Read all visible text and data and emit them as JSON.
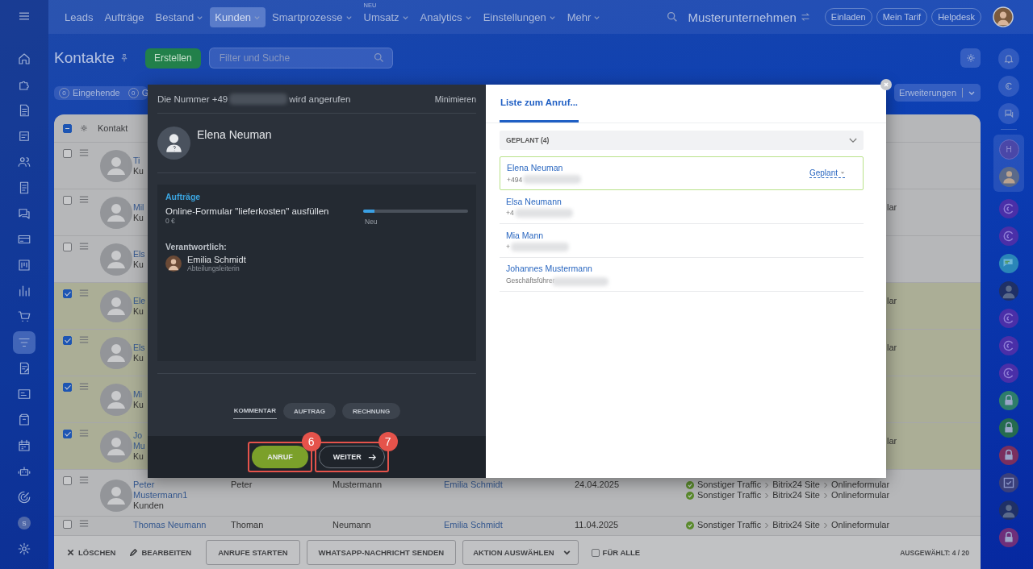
{
  "sidebar": {
    "items": [
      {
        "selected": false
      },
      {
        "selected": false
      },
      {
        "selected": false
      },
      {
        "selected": false
      },
      {
        "selected": false
      },
      {
        "selected": false
      },
      {
        "selected": false
      },
      {
        "selected": false
      },
      {
        "selected": false
      },
      {
        "selected": false
      },
      {
        "selected": false
      },
      {
        "selected": true
      },
      {
        "selected": false
      },
      {
        "selected": false
      },
      {
        "selected": false
      },
      {
        "selected": false
      },
      {
        "selected": false
      },
      {
        "selected": false
      }
    ],
    "user_initial": "S"
  },
  "top_nav": {
    "items": [
      {
        "label": "Leads",
        "selected": false,
        "dropdown": false
      },
      {
        "label": "Aufträge",
        "selected": false,
        "dropdown": false
      },
      {
        "label": "Bestand",
        "selected": false,
        "dropdown": true
      },
      {
        "label": "Kunden",
        "selected": true,
        "dropdown": true
      },
      {
        "label": "Smartprozesse",
        "selected": false,
        "dropdown": true
      },
      {
        "label": "Umsatz",
        "selected": false,
        "dropdown": true,
        "badge": "NEU"
      },
      {
        "label": "Analytics",
        "selected": false,
        "dropdown": true
      },
      {
        "label": "Einstellungen",
        "selected": false,
        "dropdown": true
      },
      {
        "label": "Mehr",
        "selected": false,
        "dropdown": true
      }
    ],
    "company": "Musterunternehmen",
    "buttons": [
      "Einladen",
      "Mein Tarif",
      "Helpdesk"
    ]
  },
  "page": {
    "title": "Kontakte",
    "create_button": "Erstellen",
    "search": {
      "placeholder": "Filter und Suche"
    },
    "counters": [
      {
        "count": "0",
        "label": "Eingehende"
      },
      {
        "count": "0",
        "label": "G"
      }
    ],
    "extensions_button": "Erweiterungen"
  },
  "table": {
    "header": {
      "indeterminate": true,
      "label": "Kontakt"
    },
    "rows": [
      {
        "kind": "covered",
        "checked": false,
        "name_lines": [
          "Ti"
        ],
        "subtitle": "Ku"
      },
      {
        "kind": "covered",
        "checked": false,
        "name_lines": [
          "Mil"
        ],
        "subtitle": "Ku",
        "tail": "lar"
      },
      {
        "kind": "covered",
        "checked": false,
        "name_lines": [
          "Els"
        ],
        "subtitle": "Ku"
      },
      {
        "kind": "covered",
        "checked": true,
        "name_lines": [
          "Ele"
        ],
        "subtitle": "Ku",
        "tail": "lar"
      },
      {
        "kind": "covered",
        "checked": true,
        "name_lines": [
          "Els"
        ],
        "subtitle": "Ku",
        "tail": "lar"
      },
      {
        "kind": "covered",
        "checked": true,
        "name_lines": [
          "Mi"
        ],
        "subtitle": "Ku"
      },
      {
        "kind": "covered",
        "checked": true,
        "name_lines": [
          "Jo",
          "Mu"
        ],
        "subtitle": "Ku",
        "tail": "lar"
      },
      {
        "kind": "full",
        "checked": false,
        "name_lines": [
          "Peter",
          "Mustermann1"
        ],
        "subtitle": "Kunden",
        "first_name": "Peter",
        "last_name": "Mustermann",
        "responsible": "Emilia Schmidt",
        "date": "24.04.2025",
        "sources": [
          [
            "Sonstiger Traffic",
            "Bitrix24 Site",
            "Onlineformular"
          ],
          [
            "Sonstiger Traffic",
            "Bitrix24 Site",
            "Onlineformular"
          ]
        ]
      },
      {
        "kind": "partial",
        "checked": false,
        "name_lines": [
          "Thomas Neumann"
        ],
        "first_name": "Thoman",
        "last_name": "Neumann",
        "responsible": "Emilia Schmidt",
        "date": "11.04.2025",
        "sources": [
          [
            "Sonstiger Traffic",
            "Bitrix24 Site",
            "Onlineformular"
          ]
        ]
      }
    ]
  },
  "bulk_actions": {
    "buttons": [
      {
        "kind": "delete",
        "label": "LÖSCHEN"
      },
      {
        "kind": "edit",
        "label": "BEARBEITEN"
      },
      {
        "kind": "outlined",
        "label": "ANRUFE STARTEN"
      },
      {
        "kind": "outlined",
        "label": "WHATSAPP-NACHRICHT SENDEN"
      },
      {
        "kind": "dropdown",
        "label": "AKTION AUSWÄHLEN"
      }
    ],
    "for_all": {
      "label": "FÜR ALLE",
      "checked": false
    },
    "selected_count": "AUSGEWÄHLT: **4 / 20**"
  },
  "call_dialog": {
    "header": {
      "prefix": "Die Nummer +49",
      "suffix": "wird angerufen",
      "minimize": "Minimieren"
    },
    "contact_name": "Elena Neuman",
    "deal": {
      "heading": "Aufträge",
      "title": "Online-Formular \"lieferkosten\" ausfüllen",
      "amount": "0 €",
      "stage": "Neu",
      "level": 0.11
    },
    "responsible": {
      "label": "Verantwortlich:",
      "name": "Emilia Schmidt",
      "role": "Abteilungsleiterin"
    },
    "tabs": [
      {
        "label": "KOMMENTAR",
        "selected": true
      },
      {
        "label": "AUFTRAG",
        "selected": false
      },
      {
        "label": "RECHNUNG",
        "selected": false
      }
    ],
    "actions": [
      {
        "kind": "call",
        "label": "ANRUF",
        "marker": "6"
      },
      {
        "kind": "next",
        "label": "WEITER",
        "marker": "7"
      }
    ]
  },
  "call_list": {
    "tabs": [
      {
        "label": "Liste zum Anruf...",
        "selected": true
      }
    ],
    "group": {
      "label": "GEPLANT (4)",
      "expanded": true
    },
    "items": [
      {
        "name": "Elena Neuman",
        "detail": "+494",
        "selected": true,
        "status": "Geplant"
      },
      {
        "name": "Elsa Neumann",
        "detail": "+4",
        "selected": false
      },
      {
        "name": "Mia Mann",
        "detail": "+",
        "selected": false
      },
      {
        "name": "Johannes Mustermann",
        "detail": "Geschäftsführer",
        "selected": false
      }
    ]
  },
  "right_rail": {
    "items": [
      {
        "kind": "bell"
      },
      {
        "kind": "swirl"
      },
      {
        "kind": "chat"
      }
    ],
    "pinned": [
      {
        "kind": "letter",
        "text": "H"
      },
      {
        "kind": "avatar"
      }
    ],
    "channels": [
      {
        "kind": "swirl"
      },
      {
        "kind": "swirl"
      },
      {
        "kind": "bubble"
      },
      {
        "kind": "avatar"
      },
      {
        "kind": "swirl"
      },
      {
        "kind": "swirl"
      },
      {
        "kind": "swirl"
      },
      {
        "kind": "lock",
        "color": "#2e7d6a"
      },
      {
        "kind": "lock",
        "color": "#256b4f"
      },
      {
        "kind": "lock",
        "color": "#7a2f5e"
      },
      {
        "kind": "task"
      },
      {
        "kind": "avatar"
      },
      {
        "kind": "lock",
        "color": "#6e2f7a"
      }
    ]
  }
}
